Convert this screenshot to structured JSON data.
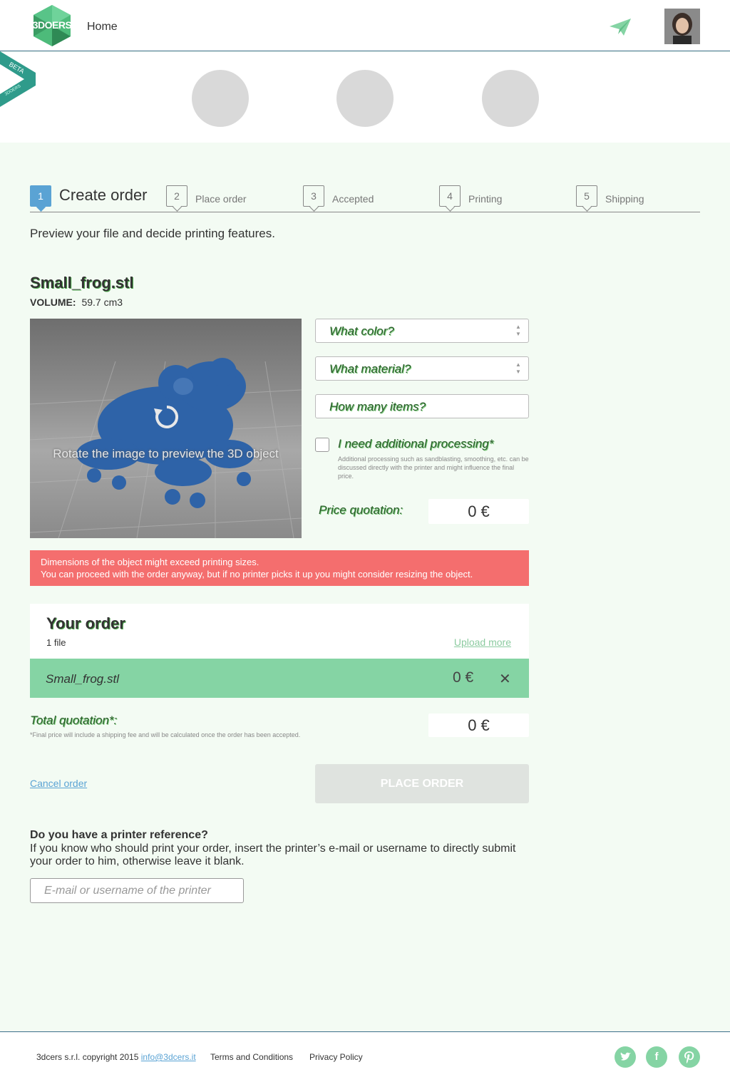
{
  "header": {
    "logo_text": "3DOERS",
    "nav_home": "Home"
  },
  "ribbon": {
    "label": "BETA",
    "sublabel": "3DOERS"
  },
  "steps": [
    {
      "num": "1",
      "label": "Create order"
    },
    {
      "num": "2",
      "label": "Place order"
    },
    {
      "num": "3",
      "label": "Accepted"
    },
    {
      "num": "4",
      "label": "Printing"
    },
    {
      "num": "5",
      "label": "Shipping"
    }
  ],
  "intro": "Preview your file and decide printing features.",
  "file": {
    "name": "Small_frog.stl",
    "volume_label": "VOLUME:",
    "volume_value": "59.7 cm3"
  },
  "preview": {
    "hint": "Rotate the image to preview the 3D object"
  },
  "form": {
    "color_label": "What color?",
    "material_label": "What material?",
    "items_label": "How many items?",
    "processing_label": "I need additional processing*",
    "processing_note": "Additional processing such as sandblasting, smoothing, etc. can be discussed directly with the printer and might influence the final price.",
    "price_label": "Price quotation:",
    "price_value": "0 €"
  },
  "alert": {
    "line1": "Dimensions of the object might exceed printing sizes.",
    "line2": "You can proceed with the order anyway, but if no printer picks it up you might consider resizing the object."
  },
  "order": {
    "title": "Your order",
    "count": "1 file",
    "upload_more": "Upload more",
    "items": [
      {
        "name": "Small_frog.stl",
        "price": "0 €"
      }
    ]
  },
  "total": {
    "label": "Total quotation*:",
    "note": "*Final price will include a shipping fee and will be calculated once the order has been accepted.",
    "value": "0 €"
  },
  "actions": {
    "cancel": "Cancel order",
    "place": "PLACE ORDER"
  },
  "printer_ref": {
    "title": "Do you have a printer reference?",
    "text": "If you know who should print your order, insert the printer’s e-mail or username to directly submit your order to him, otherwise leave it blank.",
    "placeholder": "E-mail or username of the printer"
  },
  "footer": {
    "copyright": "3dcers s.r.l. copyright 2015",
    "email": "info@3dcers.it",
    "terms": "Terms and Conditions",
    "privacy": "Privacy Policy",
    "social": [
      "twitter-icon",
      "facebook-icon",
      "pinterest-icon"
    ]
  },
  "colors": {
    "accent_green": "#85d4a4",
    "step_active": "#5aa3d4",
    "alert_red": "#f46e6e",
    "background": "#f3fbf3"
  }
}
